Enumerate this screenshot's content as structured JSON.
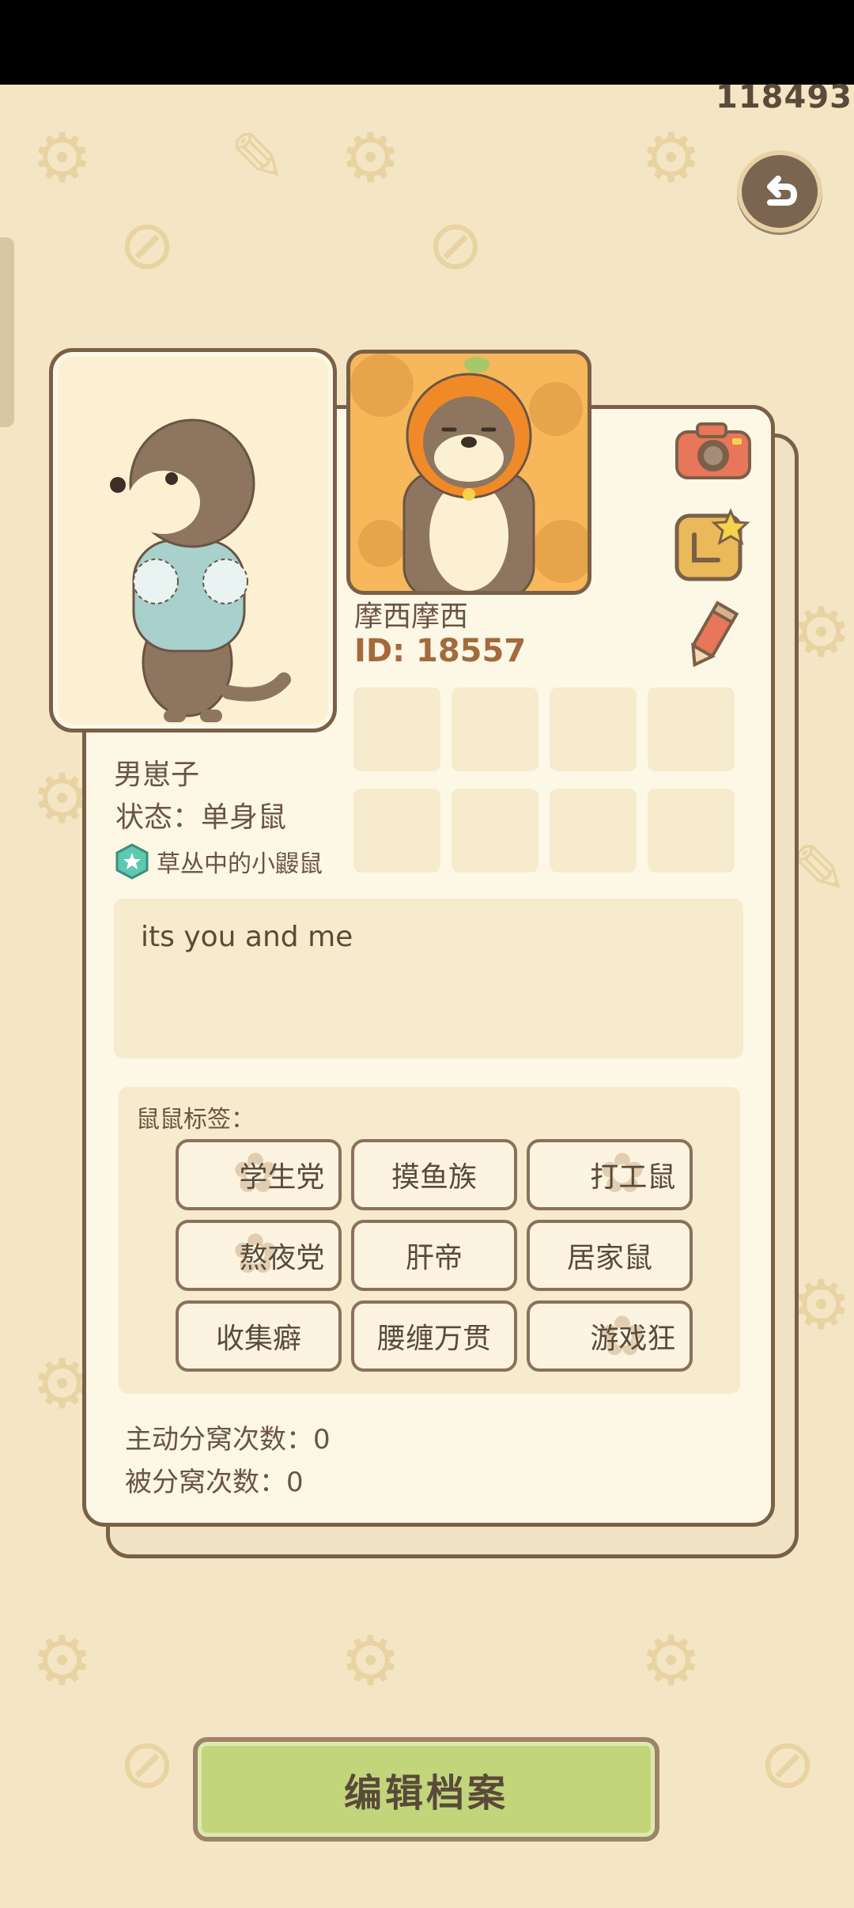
{
  "counter": "118493",
  "profile": {
    "nickname": "摩西摩西",
    "id": "ID: 18557",
    "gender": "男崽子",
    "status": "状态：单身鼠",
    "title": "草丛中的小鼹鼠",
    "bio": "its you and me"
  },
  "tags": {
    "label": "鼠鼠标签：",
    "items": [
      "学生党",
      "摸鱼族",
      "打工鼠",
      "熬夜党",
      "肝帝",
      "居家鼠",
      "收集癖",
      "腰缠万贯",
      "游戏狂"
    ]
  },
  "stats": {
    "initiated_breakups": "主动分窝次数：0",
    "passive_breakups": "被分窝次数：0"
  },
  "buttons": {
    "edit_profile": "编辑档案"
  },
  "icons": {
    "back": "back-arrow-icon",
    "camera": "camera-icon",
    "frame": "frame-sticker-icon",
    "pencil": "pencil-icon",
    "badge": "star-badge-icon"
  },
  "colors": {
    "background": "#f4e6c4",
    "card": "#fdf7e6",
    "border": "#7a6048",
    "button": "#c3d57b",
    "avatar_bg": "#f6b85a"
  }
}
